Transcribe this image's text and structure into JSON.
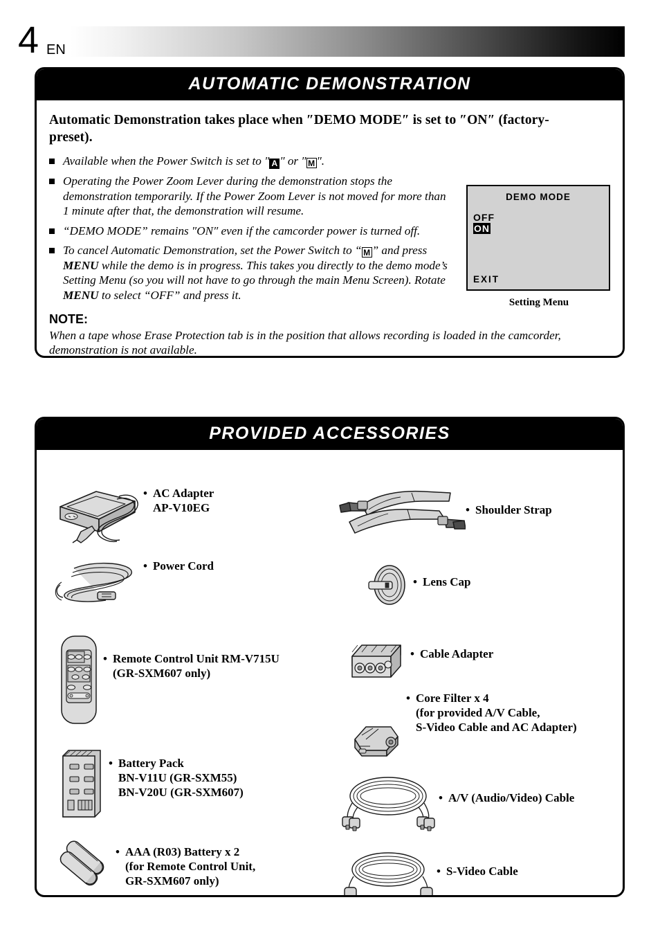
{
  "page": {
    "number": "4",
    "language": "EN"
  },
  "demo_section": {
    "title": "AUTOMATIC  DEMONSTRATION",
    "lead": "Automatic Demonstration takes place when ″DEMO MODE″ is set to ″ON″ (factory-preset).",
    "bullets": [
      {
        "parts": [
          {
            "t": "text",
            "v": "Available when the Power Switch is set to ″"
          },
          {
            "t": "glyph-a",
            "v": "A"
          },
          {
            "t": "text",
            "v": "″ or ″"
          },
          {
            "t": "glyph-m",
            "v": "M"
          },
          {
            "t": "text",
            "v": "″."
          }
        ]
      },
      {
        "parts": [
          {
            "t": "text",
            "v": "Operating the Power Zoom Lever during the demonstration stops the demonstration temporarily. If the Power Zoom Lever is not moved for more than 1 minute after that, the demonstration will resume."
          }
        ]
      },
      {
        "parts": [
          {
            "t": "text",
            "v": "“DEMO MODE” remains ″ON″ even if the camcorder power is turned off."
          }
        ]
      },
      {
        "parts": [
          {
            "t": "text",
            "v": "To cancel Automatic Demonstration, set the Power Switch to “"
          },
          {
            "t": "glyph-m",
            "v": "M"
          },
          {
            "t": "text",
            "v": "” and press "
          },
          {
            "t": "bold",
            "v": "MENU"
          },
          {
            "t": "text",
            "v": " while the demo is in progress. This takes you directly to the demo mode’s Setting Menu (so you will not have to go through the main Menu Screen). Rotate "
          },
          {
            "t": "bold",
            "v": "MENU"
          },
          {
            "t": "text",
            "v": " to select “OFF” and press it."
          }
        ]
      }
    ],
    "note_heading": "NOTE:",
    "note_body": "When a tape whose Erase Protection tab is in the position that allows recording is loaded in the camcorder, demonstration is not available."
  },
  "setting_menu": {
    "title": "DEMO  MODE",
    "option_off": "OFF",
    "option_on": "ON",
    "exit": "EXIT",
    "caption": "Setting Menu",
    "screen_bg": "#d2d2d2",
    "highlight_bg": "#000000"
  },
  "accessories_section": {
    "title": "PROVIDED  ACCESSORIES",
    "left_items": [
      {
        "icon": "ac-adapter-icon",
        "label": "AC Adapter\nAP-V10EG"
      },
      {
        "icon": "power-cord-icon",
        "label": "Power Cord"
      },
      {
        "icon": "remote-control-icon",
        "label": "Remote Control Unit RM-V715U\n(GR-SXM607 only)"
      },
      {
        "icon": "battery-pack-icon",
        "label": "Battery Pack\nBN-V11U (GR-SXM55)\nBN-V20U (GR-SXM607)"
      },
      {
        "icon": "aaa-battery-icon",
        "label": "AAA (R03) Battery x 2\n(for Remote Control Unit,\nGR-SXM607 only)"
      }
    ],
    "right_items": [
      {
        "icon": "shoulder-strap-icon",
        "label": "Shoulder Strap"
      },
      {
        "icon": "lens-cap-icon",
        "label": "Lens Cap"
      },
      {
        "icon": "cable-adapter-icon",
        "label": "Cable Adapter"
      },
      {
        "icon": "core-filter-icon",
        "label": "Core Filter x 4\n(for provided A/V Cable,\nS-Video Cable and AC Adapter)"
      },
      {
        "icon": "av-cable-icon",
        "label": "A/V (Audio/Video) Cable"
      },
      {
        "icon": "s-video-cable-icon",
        "label": "S-Video Cable"
      }
    ]
  },
  "colors": {
    "bar_black": "#000000",
    "art_fill": "#d5d5d5",
    "art_fill_dark": "#9a9a9a",
    "art_stroke": "#1a1a1a"
  }
}
